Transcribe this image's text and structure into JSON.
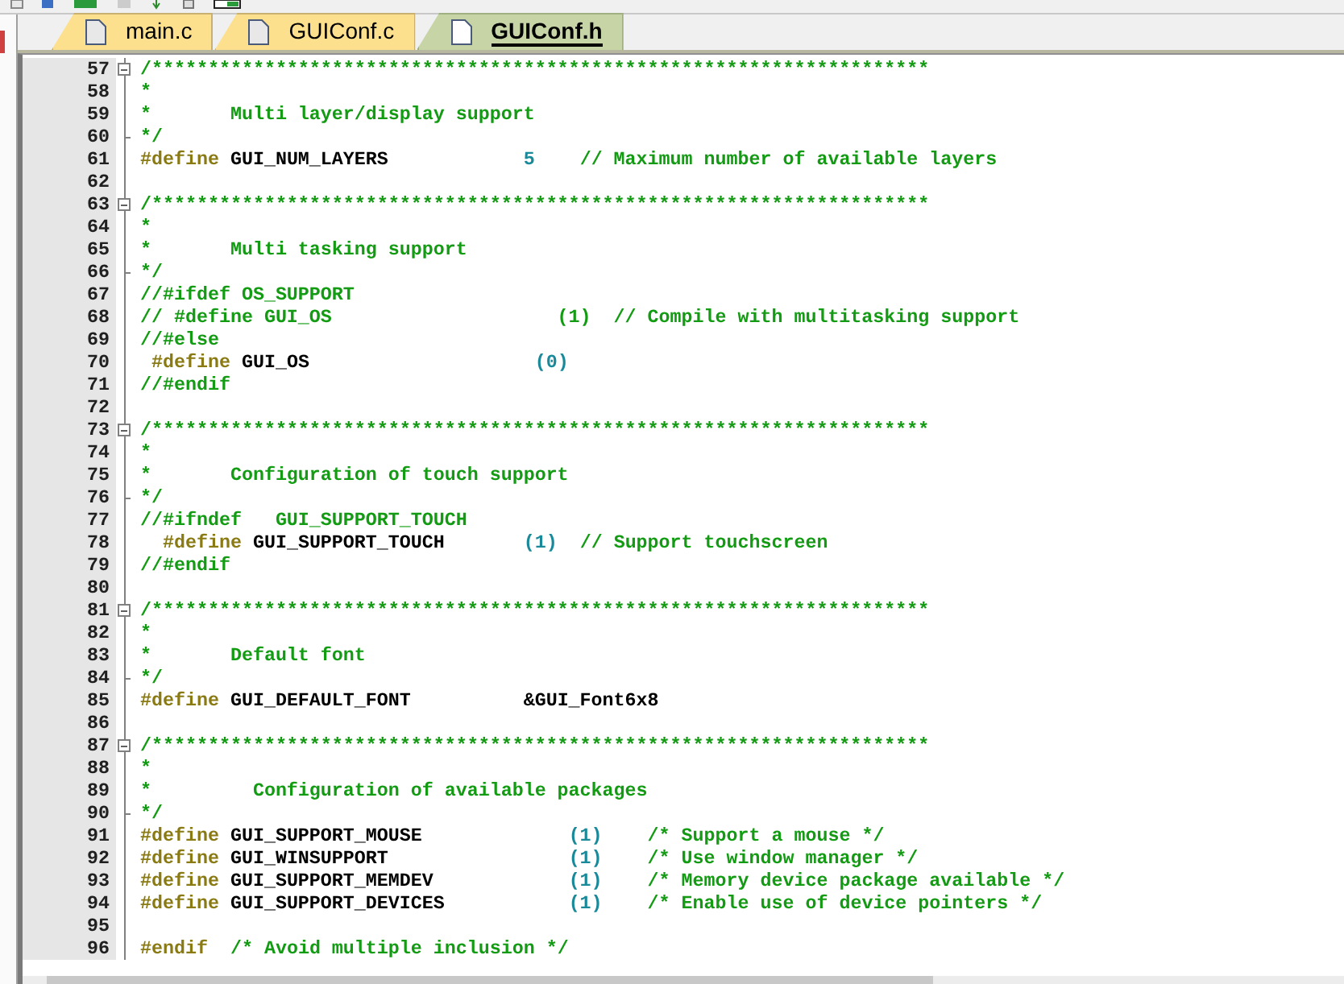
{
  "tabs": [
    {
      "label": "main.c",
      "selected": false
    },
    {
      "label": "GUIConf.c",
      "selected": false
    },
    {
      "label": "GUIConf.h",
      "selected": true
    }
  ],
  "editor": {
    "lines": [
      {
        "number": "57",
        "fold_box": true,
        "fold_end": false,
        "tokens": [
          {
            "kind": "comment",
            "text": "/*********************************************************************"
          }
        ]
      },
      {
        "number": "58",
        "fold_box": false,
        "fold_end": false,
        "tokens": [
          {
            "kind": "comment",
            "text": "*"
          }
        ]
      },
      {
        "number": "59",
        "fold_box": false,
        "fold_end": false,
        "tokens": [
          {
            "kind": "comment",
            "text": "*       Multi layer/display support"
          }
        ]
      },
      {
        "number": "60",
        "fold_box": false,
        "fold_end": true,
        "tokens": [
          {
            "kind": "comment",
            "text": "*/"
          }
        ]
      },
      {
        "number": "61",
        "fold_box": false,
        "fold_end": false,
        "tokens": [
          {
            "kind": "preprocessor",
            "text": "#define"
          },
          {
            "kind": "identifier",
            "text": " GUI_NUM_LAYERS            "
          },
          {
            "kind": "number",
            "text": "5"
          },
          {
            "kind": "comment",
            "text": "    // Maximum number of available layers"
          }
        ]
      },
      {
        "number": "62",
        "fold_box": false,
        "fold_end": false
      },
      {
        "number": "63",
        "fold_box": true,
        "fold_end": false,
        "tokens": [
          {
            "kind": "comment",
            "text": "/*********************************************************************"
          }
        ]
      },
      {
        "number": "64",
        "fold_box": false,
        "fold_end": false,
        "tokens": [
          {
            "kind": "comment",
            "text": "*"
          }
        ]
      },
      {
        "number": "65",
        "fold_box": false,
        "fold_end": false,
        "tokens": [
          {
            "kind": "comment",
            "text": "*       Multi tasking support"
          }
        ]
      },
      {
        "number": "66",
        "fold_box": false,
        "fold_end": true,
        "tokens": [
          {
            "kind": "comment",
            "text": "*/"
          }
        ]
      },
      {
        "number": "67",
        "fold_box": false,
        "fold_end": false,
        "tokens": [
          {
            "kind": "comment",
            "text": "//#ifdef OS_SUPPORT"
          }
        ]
      },
      {
        "number": "68",
        "fold_box": false,
        "fold_end": false,
        "tokens": [
          {
            "kind": "comment",
            "text": "// #define GUI_OS                    (1)  // Compile with multitasking support"
          }
        ]
      },
      {
        "number": "69",
        "fold_box": false,
        "fold_end": false,
        "tokens": [
          {
            "kind": "comment",
            "text": "//#else"
          }
        ]
      },
      {
        "number": "70",
        "fold_box": false,
        "fold_end": false,
        "tokens": [
          {
            "kind": "preprocessor",
            "text": " #define"
          },
          {
            "kind": "identifier",
            "text": " GUI_OS                    "
          },
          {
            "kind": "number",
            "text": "(0)"
          }
        ]
      },
      {
        "number": "71",
        "fold_box": false,
        "fold_end": false,
        "tokens": [
          {
            "kind": "comment",
            "text": "//#endif"
          }
        ]
      },
      {
        "number": "72",
        "fold_box": false,
        "fold_end": false
      },
      {
        "number": "73",
        "fold_box": true,
        "fold_end": false,
        "tokens": [
          {
            "kind": "comment",
            "text": "/*********************************************************************"
          }
        ]
      },
      {
        "number": "74",
        "fold_box": false,
        "fold_end": false,
        "tokens": [
          {
            "kind": "comment",
            "text": "*"
          }
        ]
      },
      {
        "number": "75",
        "fold_box": false,
        "fold_end": false,
        "tokens": [
          {
            "kind": "comment",
            "text": "*       Configuration of touch support"
          }
        ]
      },
      {
        "number": "76",
        "fold_box": false,
        "fold_end": true,
        "tokens": [
          {
            "kind": "comment",
            "text": "*/"
          }
        ]
      },
      {
        "number": "77",
        "fold_box": false,
        "fold_end": false,
        "tokens": [
          {
            "kind": "comment",
            "text": "//#ifndef   GUI_SUPPORT_TOUCH"
          }
        ]
      },
      {
        "number": "78",
        "fold_box": false,
        "fold_end": false,
        "tokens": [
          {
            "kind": "preprocessor",
            "text": "  #define"
          },
          {
            "kind": "identifier",
            "text": " GUI_SUPPORT_TOUCH       "
          },
          {
            "kind": "number",
            "text": "(1)"
          },
          {
            "kind": "comment",
            "text": "  // Support touchscreen"
          }
        ]
      },
      {
        "number": "79",
        "fold_box": false,
        "fold_end": false,
        "tokens": [
          {
            "kind": "comment",
            "text": "//#endif"
          }
        ]
      },
      {
        "number": "80",
        "fold_box": false,
        "fold_end": false
      },
      {
        "number": "81",
        "fold_box": true,
        "fold_end": false,
        "tokens": [
          {
            "kind": "comment",
            "text": "/*********************************************************************"
          }
        ]
      },
      {
        "number": "82",
        "fold_box": false,
        "fold_end": false,
        "tokens": [
          {
            "kind": "comment",
            "text": "*"
          }
        ]
      },
      {
        "number": "83",
        "fold_box": false,
        "fold_end": false,
        "tokens": [
          {
            "kind": "comment",
            "text": "*       Default font"
          }
        ]
      },
      {
        "number": "84",
        "fold_box": false,
        "fold_end": true,
        "tokens": [
          {
            "kind": "comment",
            "text": "*/"
          }
        ]
      },
      {
        "number": "85",
        "fold_box": false,
        "fold_end": false,
        "tokens": [
          {
            "kind": "preprocessor",
            "text": "#define"
          },
          {
            "kind": "identifier",
            "text": " GUI_DEFAULT_FONT          &GUI_Font6x8"
          }
        ]
      },
      {
        "number": "86",
        "fold_box": false,
        "fold_end": false
      },
      {
        "number": "87",
        "fold_box": true,
        "fold_end": false,
        "tokens": [
          {
            "kind": "comment",
            "text": "/*********************************************************************"
          }
        ]
      },
      {
        "number": "88",
        "fold_box": false,
        "fold_end": false,
        "tokens": [
          {
            "kind": "comment",
            "text": "*"
          }
        ]
      },
      {
        "number": "89",
        "fold_box": false,
        "fold_end": false,
        "tokens": [
          {
            "kind": "comment",
            "text": "*         Configuration of available packages"
          }
        ]
      },
      {
        "number": "90",
        "fold_box": false,
        "fold_end": true,
        "tokens": [
          {
            "kind": "comment",
            "text": "*/"
          }
        ]
      },
      {
        "number": "91",
        "fold_box": false,
        "fold_end": false,
        "tokens": [
          {
            "kind": "preprocessor",
            "text": "#define"
          },
          {
            "kind": "identifier",
            "text": " GUI_SUPPORT_MOUSE             "
          },
          {
            "kind": "number",
            "text": "(1)"
          },
          {
            "kind": "comment",
            "text": "    /* Support a mouse */"
          }
        ]
      },
      {
        "number": "92",
        "fold_box": false,
        "fold_end": false,
        "tokens": [
          {
            "kind": "preprocessor",
            "text": "#define"
          },
          {
            "kind": "identifier",
            "text": " GUI_WINSUPPORT                "
          },
          {
            "kind": "number",
            "text": "(1)"
          },
          {
            "kind": "comment",
            "text": "    /* Use window manager */"
          }
        ]
      },
      {
        "number": "93",
        "fold_box": false,
        "fold_end": false,
        "tokens": [
          {
            "kind": "preprocessor",
            "text": "#define"
          },
          {
            "kind": "identifier",
            "text": " GUI_SUPPORT_MEMDEV            "
          },
          {
            "kind": "number",
            "text": "(1)"
          },
          {
            "kind": "comment",
            "text": "    /* Memory device package available */"
          }
        ]
      },
      {
        "number": "94",
        "fold_box": false,
        "fold_end": false,
        "tokens": [
          {
            "kind": "preprocessor",
            "text": "#define"
          },
          {
            "kind": "identifier",
            "text": " GUI_SUPPORT_DEVICES           "
          },
          {
            "kind": "number",
            "text": "(1)"
          },
          {
            "kind": "comment",
            "text": "    /* Enable use of device pointers */"
          }
        ]
      },
      {
        "number": "95",
        "fold_box": false,
        "fold_end": false
      },
      {
        "number": "96",
        "fold_box": false,
        "fold_end": false,
        "tokens": [
          {
            "kind": "preprocessor",
            "text": "#endif"
          },
          {
            "kind": "comment",
            "text": "  /* Avoid multiple inclusion */"
          }
        ]
      }
    ]
  }
}
